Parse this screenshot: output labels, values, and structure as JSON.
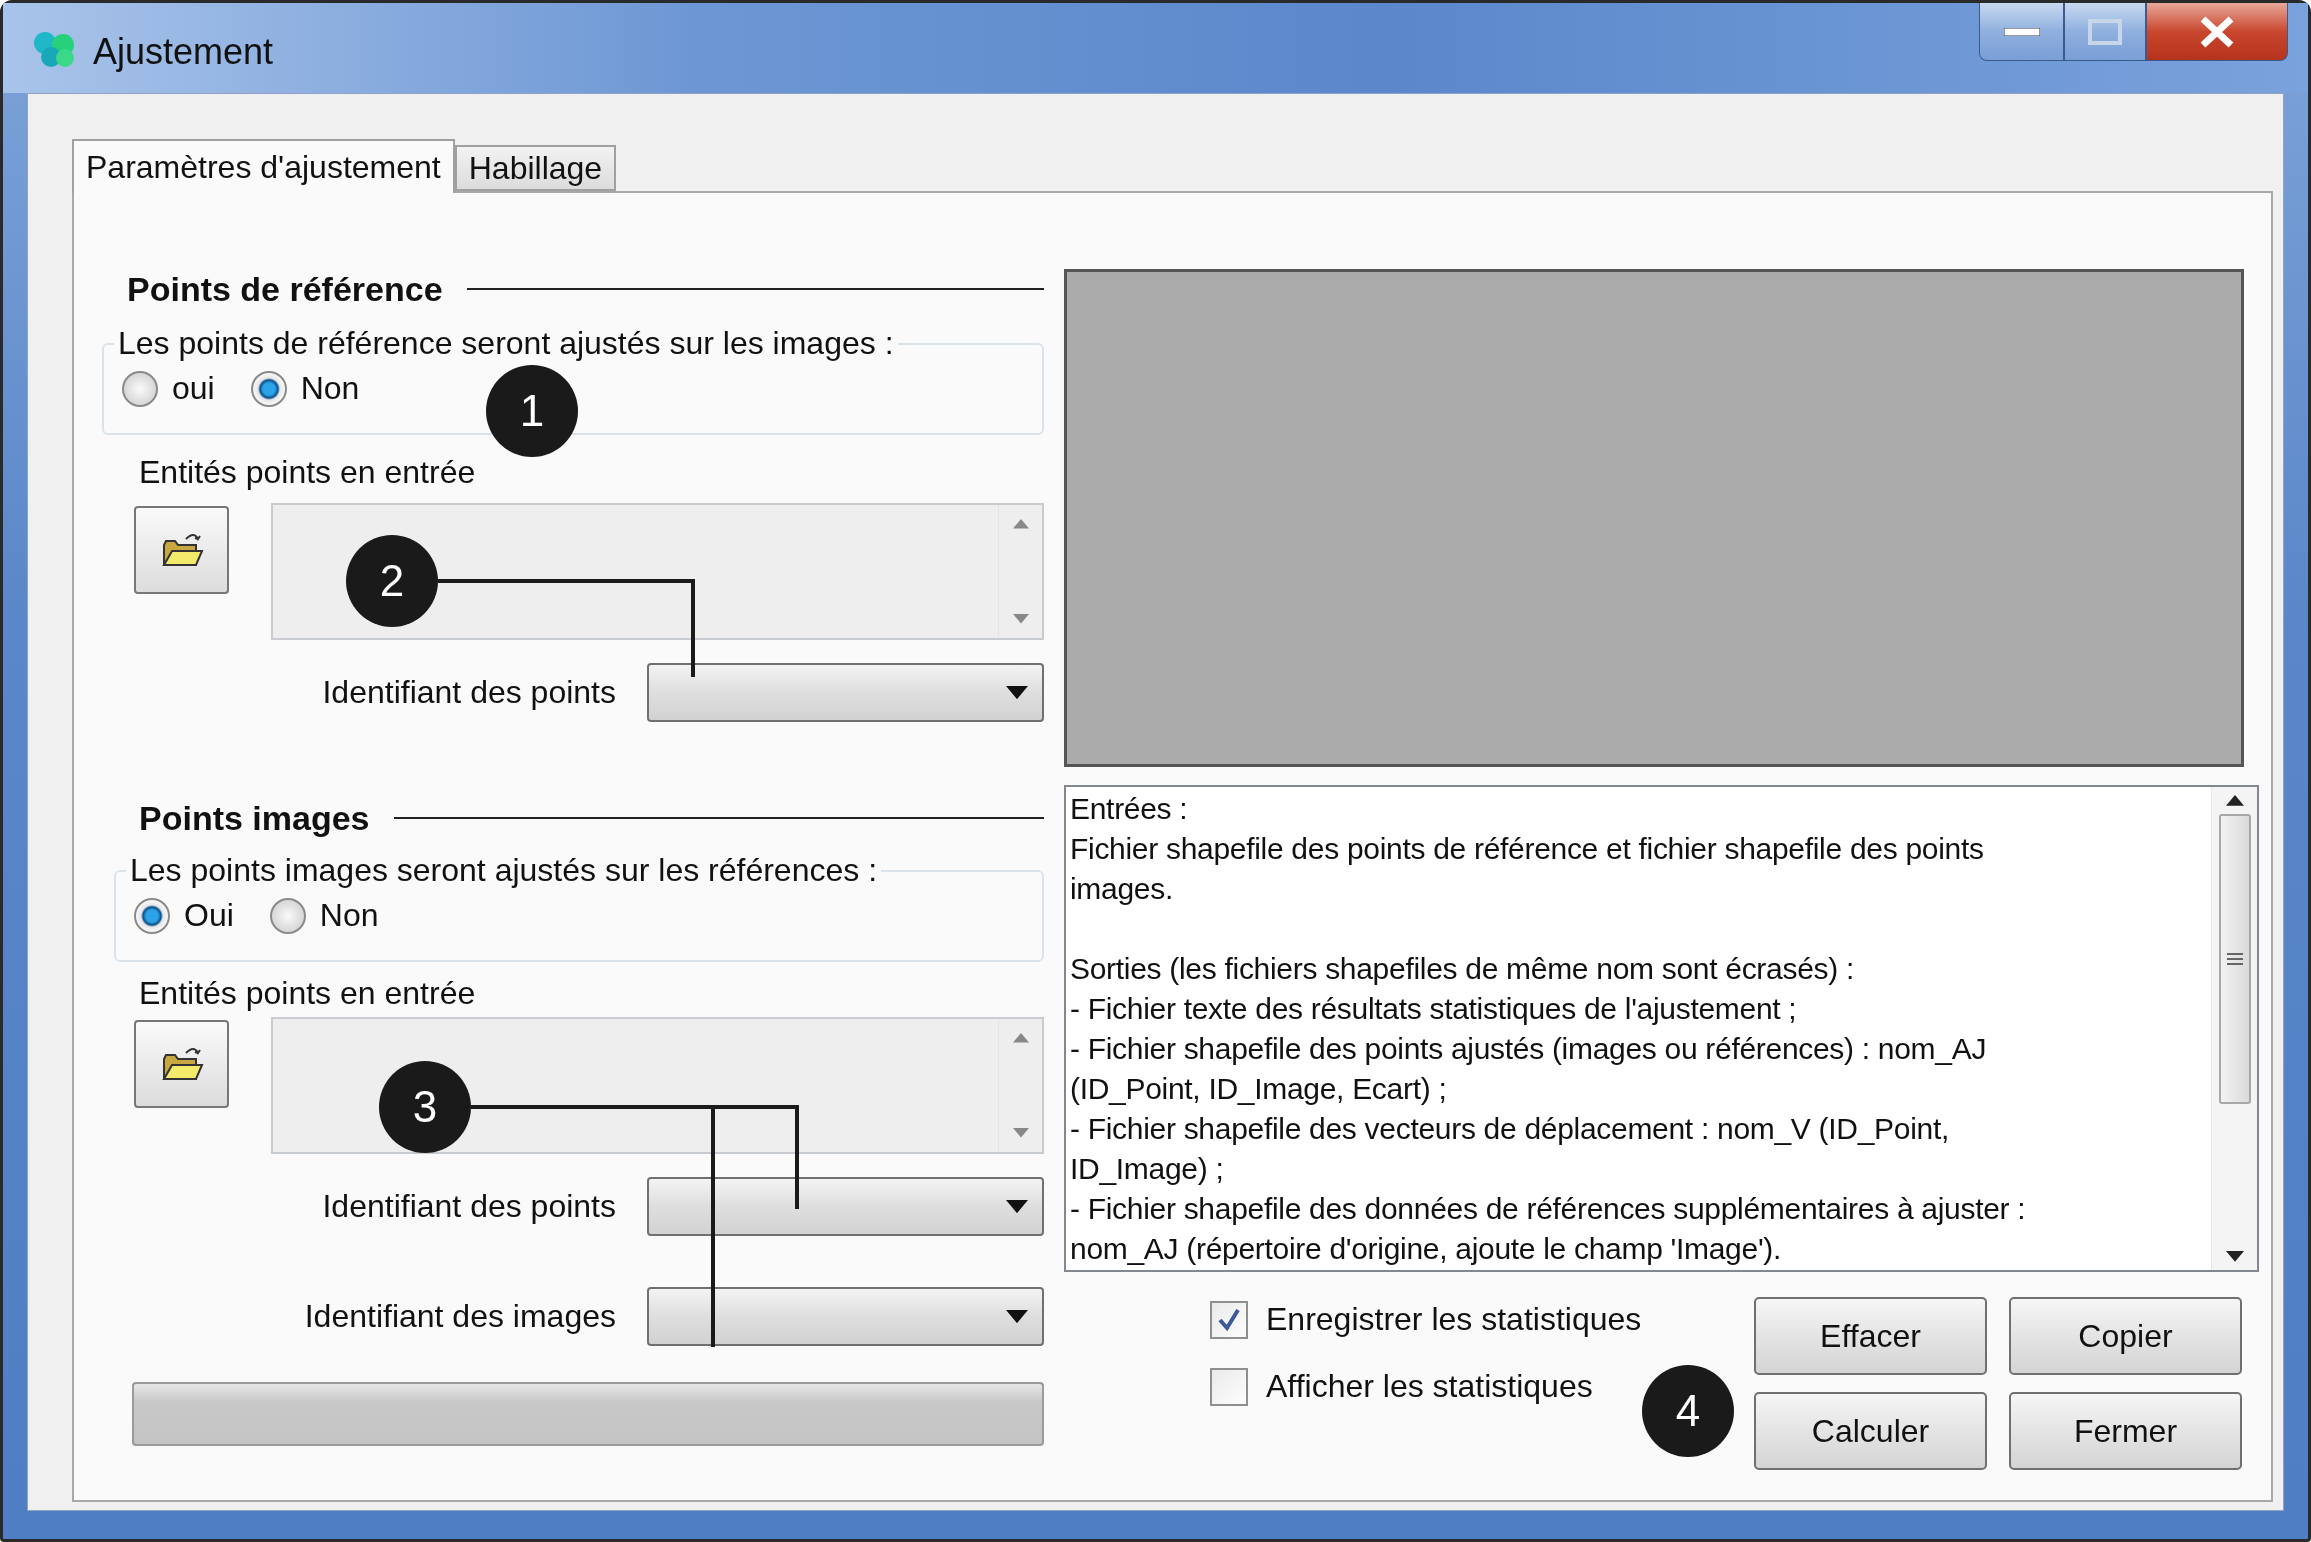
{
  "window": {
    "title": "Ajustement"
  },
  "tabs": [
    {
      "label": "Paramètres d'ajustement",
      "selected": true
    },
    {
      "label": "Habillage",
      "selected": false
    }
  ],
  "sections": [
    {
      "heading": "Points de référence",
      "group_label": "Les points de référence seront ajustés sur les images :",
      "options": [
        {
          "label": "oui",
          "selected": false
        },
        {
          "label": "Non",
          "selected": true
        }
      ],
      "input_label": "Entités points en entrée",
      "dropdowns": [
        {
          "label": "Identifiant des points"
        }
      ]
    },
    {
      "heading": "Points images",
      "group_label": "Les points images seront ajustés sur les références :",
      "options": [
        {
          "label": "Oui",
          "selected": true
        },
        {
          "label": "Non",
          "selected": false
        }
      ],
      "input_label": "Entités points en entrée",
      "dropdowns": [
        {
          "label": "Identifiant des points"
        },
        {
          "label": "Identifiant des images"
        }
      ]
    }
  ],
  "progress": {
    "level": 0
  },
  "output": {
    "paragraphs": [
      [
        "Entrées :",
        "Fichier shapefile des points de référence et fichier shapefile des points",
        "images."
      ],
      [
        "Sorties (les fichiers shapefiles de même nom sont écrasés) :",
        "- Fichier texte des résultats statistiques de l'ajustement ;",
        "- Fichier shapefile des points ajustés (images ou références) : nom_AJ",
        "(ID_Point, ID_Image, Ecart) ;",
        "- Fichier shapefile des vecteurs de déplacement : nom_V (ID_Point,",
        "ID_Image) ;",
        "- Fichier shapefile des données de références supplémentaires à ajuster :",
        "nom_AJ (répertoire d'origine, ajoute le champ 'Image')."
      ]
    ]
  },
  "checkboxes": [
    {
      "label": "Enregistrer les statistiques",
      "checked": true
    },
    {
      "label": "Afficher les statistiques",
      "checked": false
    }
  ],
  "buttons": [
    "Effacer",
    "Copier",
    "Calculer",
    "Fermer"
  ],
  "callouts": [
    "1",
    "2",
    "3",
    "4"
  ]
}
